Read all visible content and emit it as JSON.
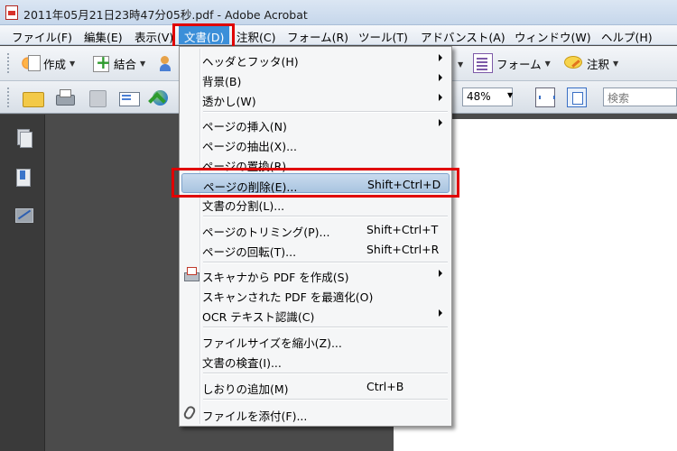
{
  "window": {
    "title": "2011年05月21日23時47分05秒.pdf - Adobe Acrobat"
  },
  "menubar": {
    "items": [
      "ファイル(F)",
      "編集(E)",
      "表示(V)",
      "文書(D)",
      "注釈(C)",
      "フォーム(R)",
      "ツール(T)",
      "アドバンスト(A)",
      "ウィンドウ(W)",
      "ヘルプ(H)"
    ],
    "active_index": 3
  },
  "toolbar": {
    "create_label": "作成",
    "combine_label": "結合",
    "form_label": "フォーム",
    "comment_label": "注釈",
    "zoom_value": "48%",
    "search_placeholder": "検索"
  },
  "document_menu": {
    "items": [
      {
        "label": "ヘッダとフッタ(H)",
        "shortcut": "",
        "submenu": true
      },
      {
        "label": "背景(B)",
        "shortcut": "",
        "submenu": true
      },
      {
        "label": "透かし(W)",
        "shortcut": "",
        "submenu": true
      },
      {
        "label": "ページの挿入(N)",
        "shortcut": "",
        "submenu": true
      },
      {
        "label": "ページの抽出(X)...",
        "shortcut": "",
        "submenu": false
      },
      {
        "label": "ページの置換(R)...",
        "shortcut": "",
        "submenu": false
      },
      {
        "label": "ページの削除(E)...",
        "shortcut": "Shift+Ctrl+D",
        "submenu": false,
        "highlighted": true
      },
      {
        "label": "文書の分割(L)...",
        "shortcut": "",
        "submenu": false
      },
      {
        "label": "ページのトリミング(P)...",
        "shortcut": "Shift+Ctrl+T",
        "submenu": false
      },
      {
        "label": "ページの回転(T)...",
        "shortcut": "Shift+Ctrl+R",
        "submenu": false
      },
      {
        "label": "スキャナから PDF を作成(S)",
        "shortcut": "",
        "submenu": true
      },
      {
        "label": "スキャンされた PDF を最適化(O)",
        "shortcut": "",
        "submenu": false
      },
      {
        "label": "OCR テキスト認識(C)",
        "shortcut": "",
        "submenu": true
      },
      {
        "label": "ファイルサイズを縮小(Z)...",
        "shortcut": "",
        "submenu": false
      },
      {
        "label": "文書の検査(I)...",
        "shortcut": "",
        "submenu": false
      },
      {
        "label": "しおりの追加(M)",
        "shortcut": "Ctrl+B",
        "submenu": false
      },
      {
        "label": "ファイルを添付(F)...",
        "shortcut": "",
        "submenu": false
      }
    ]
  },
  "colors": {
    "menu_active": "#3b8fd9",
    "callout_red": "#e00000",
    "item_highlight": "#a9c4e0"
  }
}
